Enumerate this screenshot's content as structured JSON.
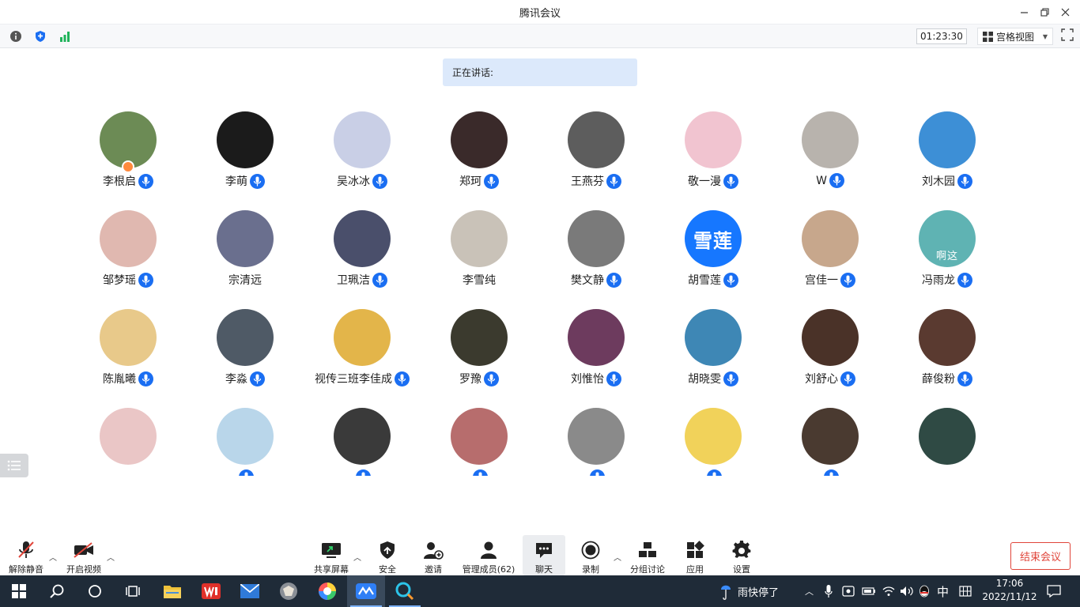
{
  "window": {
    "title": "腾讯会议"
  },
  "topbar": {
    "timer": "01:23:30",
    "view_label": "宫格视图"
  },
  "speaking": {
    "label": "正在讲话:"
  },
  "participants": [
    {
      "name": "李根启",
      "mic": true,
      "bg": "#6c8b55",
      "avatar_text": "",
      "host": true
    },
    {
      "name": "李萌",
      "mic": true,
      "bg": "#1b1b1b",
      "avatar_text": ""
    },
    {
      "name": "吴冰冰",
      "mic": true,
      "bg": "#c9cfe6",
      "avatar_text": ""
    },
    {
      "name": "郑珂",
      "mic": true,
      "bg": "#3a2a2a",
      "avatar_text": ""
    },
    {
      "name": "王燕芬",
      "mic": true,
      "bg": "#5d5d5d",
      "avatar_text": ""
    },
    {
      "name": "敬一漫",
      "mic": true,
      "bg": "#f1c4d0",
      "avatar_text": ""
    },
    {
      "name": "W",
      "mic": true,
      "bg": "#b8b3ad",
      "avatar_text": ""
    },
    {
      "name": "刘木园",
      "mic": true,
      "bg": "#3d8fd6",
      "avatar_text": ""
    },
    {
      "name": "邹梦瑶",
      "mic": true,
      "bg": "#e0b8b0",
      "avatar_text": ""
    },
    {
      "name": "宗清远",
      "mic": false,
      "bg": "#6a6f8e",
      "avatar_text": ""
    },
    {
      "name": "卫珮洁",
      "mic": true,
      "bg": "#4a4f6b",
      "avatar_text": ""
    },
    {
      "name": "李雪纯",
      "mic": false,
      "bg": "#c9c2b8",
      "avatar_text": ""
    },
    {
      "name": "樊文静",
      "mic": true,
      "bg": "#7a7a7a",
      "avatar_text": ""
    },
    {
      "name": "胡雪莲",
      "mic": true,
      "bg": "#1677ff",
      "avatar_text": "雪莲"
    },
    {
      "name": "宫佳一",
      "mic": true,
      "bg": "#c7a78c",
      "avatar_text": ""
    },
    {
      "name": "冯雨龙",
      "mic": true,
      "bg": "#5fb3b3",
      "avatar_text": "啊这"
    },
    {
      "name": "陈胤曦",
      "mic": true,
      "bg": "#e8c98a",
      "avatar_text": ""
    },
    {
      "name": "李淼",
      "mic": true,
      "bg": "#4f5a66",
      "avatar_text": ""
    },
    {
      "name": "视传三班李佳成",
      "mic": true,
      "bg": "#e3b54a",
      "avatar_text": ""
    },
    {
      "name": "罗豫",
      "mic": true,
      "bg": "#3b3a2e",
      "avatar_text": ""
    },
    {
      "name": "刘惟怡",
      "mic": true,
      "bg": "#6d3b5e",
      "avatar_text": ""
    },
    {
      "name": "胡晓雯",
      "mic": true,
      "bg": "#3e87b5",
      "avatar_text": ""
    },
    {
      "name": "刘舒心",
      "mic": true,
      "bg": "#4a3228",
      "avatar_text": ""
    },
    {
      "name": "薛俊粉",
      "mic": true,
      "bg": "#5a3a30",
      "avatar_text": ""
    },
    {
      "name": "",
      "mic": false,
      "bg": "#eac6c6",
      "avatar_text": ""
    },
    {
      "name": "",
      "mic": true,
      "bg": "#b9d6ea",
      "avatar_text": ""
    },
    {
      "name": "",
      "mic": true,
      "bg": "#3a3a3a",
      "avatar_text": ""
    },
    {
      "name": "",
      "mic": true,
      "bg": "#b76d6d",
      "avatar_text": ""
    },
    {
      "name": "",
      "mic": true,
      "bg": "#8a8a8a",
      "avatar_text": ""
    },
    {
      "name": "",
      "mic": true,
      "bg": "#f1d25a",
      "avatar_text": ""
    },
    {
      "name": "",
      "mic": true,
      "bg": "#4a3a30",
      "avatar_text": ""
    },
    {
      "name": "",
      "mic": false,
      "bg": "#2f4a44",
      "avatar_text": ""
    }
  ],
  "controls": {
    "unmute": "解除静音",
    "start_video": "开启视频",
    "share": "共享屏幕",
    "security": "安全",
    "invite": "邀请",
    "manage": "管理成员(62)",
    "chat": "聊天",
    "record": "录制",
    "breakout": "分组讨论",
    "apps": "应用",
    "settings": "设置",
    "end": "结束会议"
  },
  "taskbar": {
    "weather": "雨快停了",
    "ime": "中",
    "time": "17:06",
    "date": "2022/11/12"
  }
}
